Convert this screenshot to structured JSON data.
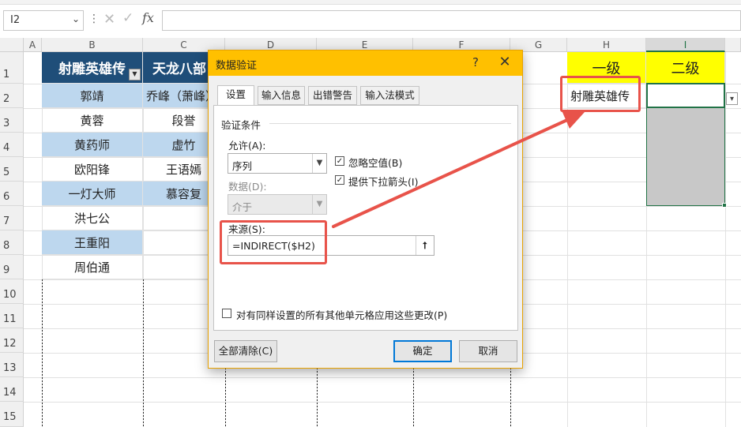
{
  "formula_bar": {
    "name_box": "I2",
    "dots": "⋮",
    "cancel_icon": "✕",
    "enter_icon": "✓",
    "fx": "fx",
    "formula": ""
  },
  "columns": [
    "A",
    "B",
    "C",
    "D",
    "E",
    "F",
    "G",
    "H",
    "I"
  ],
  "selected_column": "I",
  "rows": [
    "1",
    "2",
    "3",
    "4",
    "5",
    "6",
    "7",
    "8",
    "9",
    "10",
    "11",
    "12",
    "13",
    "14",
    "15"
  ],
  "sheet": {
    "B1": "射雕英雄传",
    "C1": "天龙八部",
    "B": [
      "郭靖",
      "黄蓉",
      "黄药师",
      "欧阳锋",
      "一灯大师",
      "洪七公",
      "王重阳",
      "周伯通"
    ],
    "C": [
      "乔峰（萧峰）",
      "段誉",
      "虚竹",
      "王语嫣",
      "慕容复"
    ],
    "H1": "一级",
    "I1": "二级",
    "H2": "射雕英雄传",
    "filter_icon": "▼",
    "dropdown_icon": "▾"
  },
  "dialog": {
    "title": "数据验证",
    "help": "?",
    "close": "✕",
    "tabs": [
      "设置",
      "输入信息",
      "出错警告",
      "输入法模式"
    ],
    "active_tab": 0,
    "section_title": "验证条件",
    "allow_label": "允许(A):",
    "allow_value": "序列",
    "data_label": "数据(D):",
    "data_value": "介于",
    "ignore_blank_label": "忽略空值(B)",
    "ignore_blank": true,
    "dropdown_arrow_label": "提供下拉箭头(I)",
    "dropdown_arrow": true,
    "source_label": "来源(S):",
    "source_value": "=INDIRECT($H2)",
    "apply_all_label": "对有同样设置的所有其他单元格应用这些更改(P)",
    "apply_all": false,
    "clear_all_button": "全部清除(C)",
    "ok_button": "确定",
    "cancel_button": "取消",
    "collapse_icon": "⭡"
  },
  "colors": {
    "header_blue": "#1f4e79",
    "light_blue": "#bdd7ee",
    "yellow": "#ffff00",
    "dialog_title": "#ffc000",
    "annotation_red": "#e8534a",
    "excel_green": "#217346"
  }
}
